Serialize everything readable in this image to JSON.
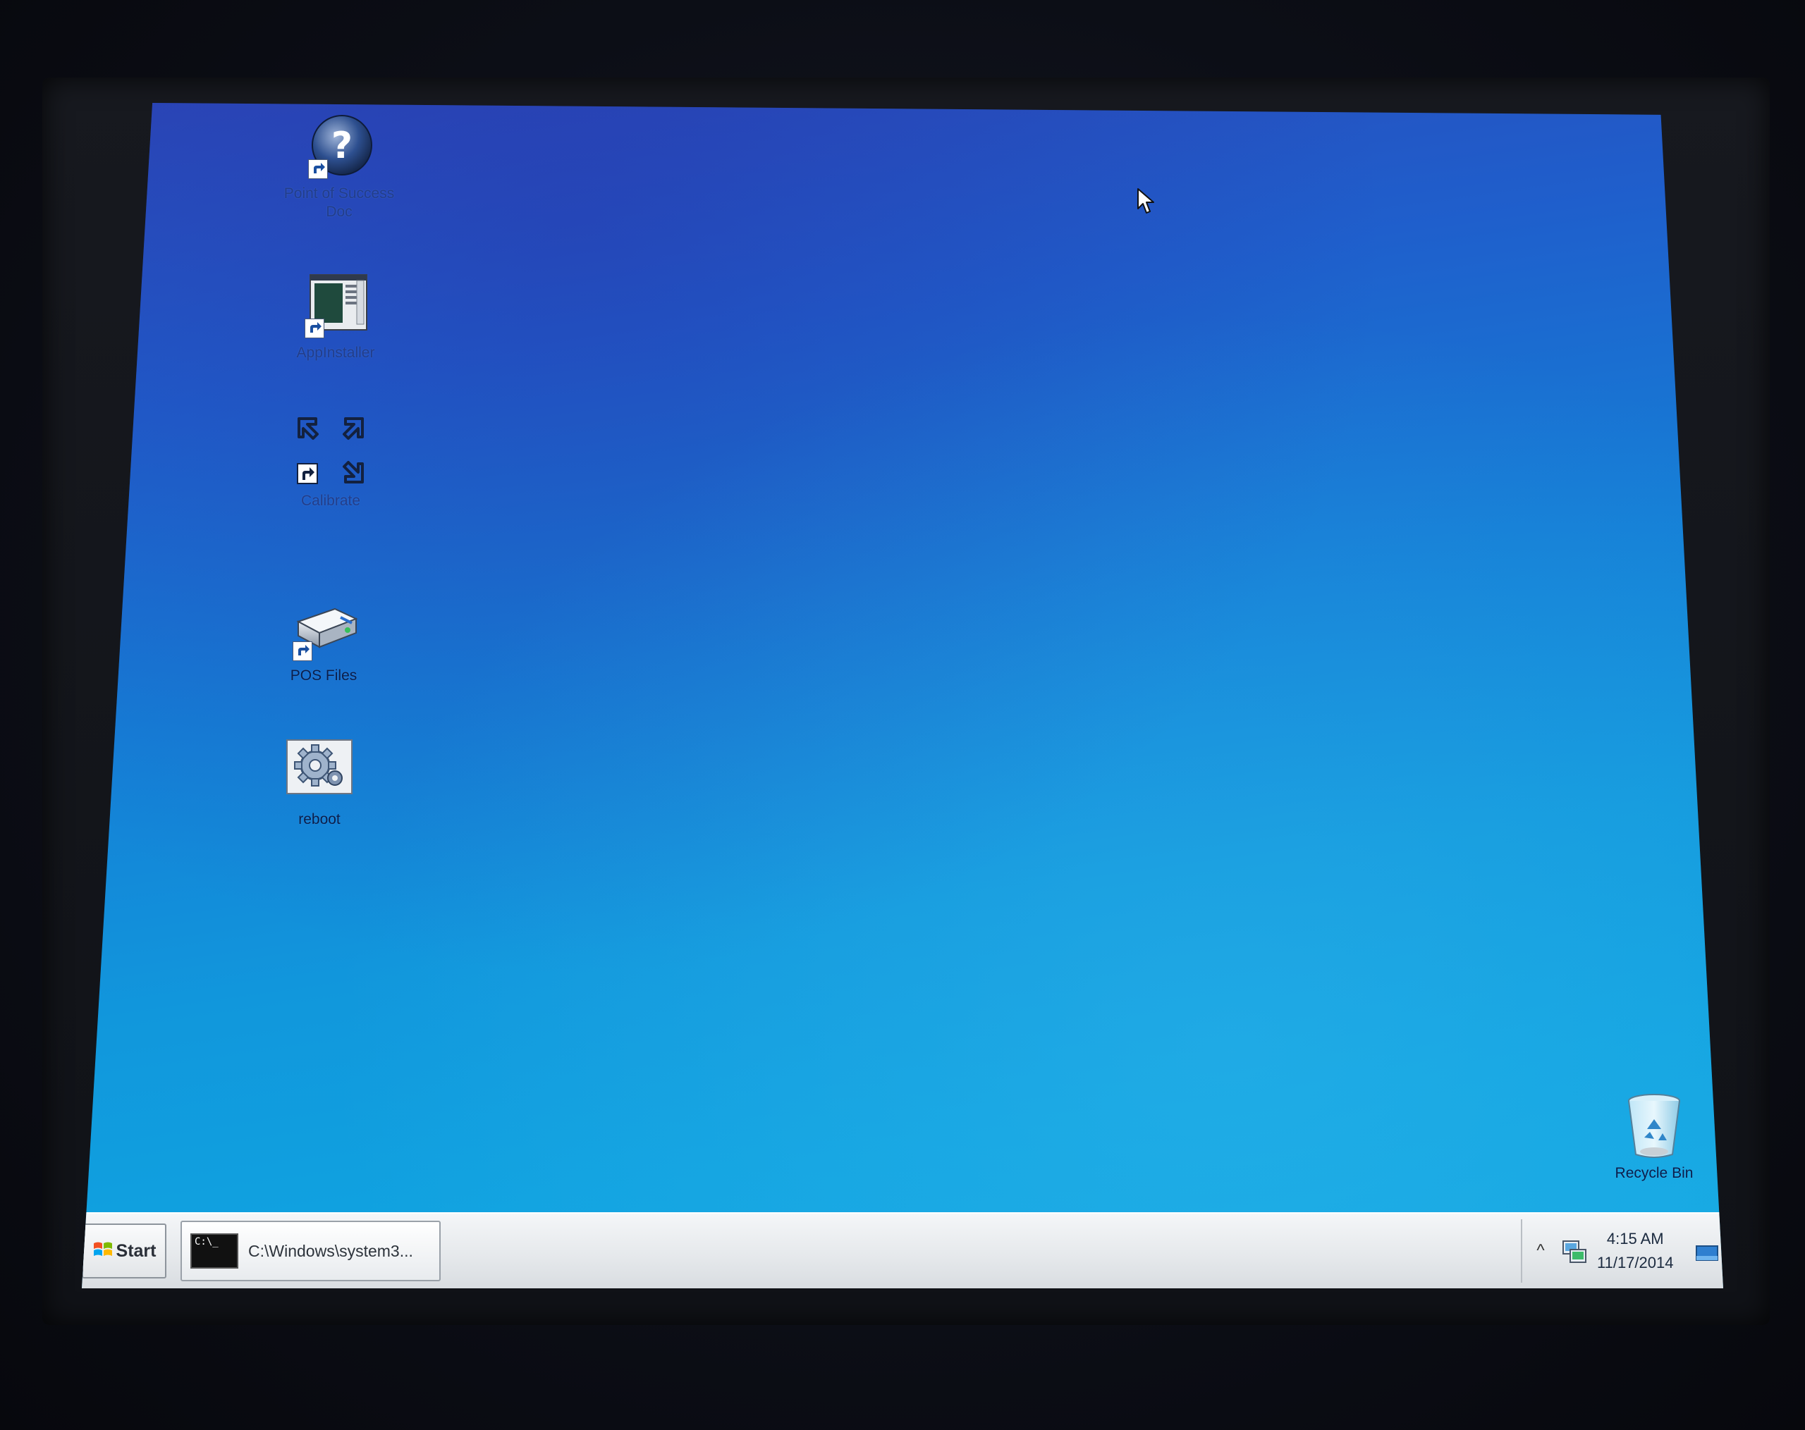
{
  "desktop": {
    "icons": [
      {
        "label": "Point of Success Doc",
        "icon": "help-question-icon",
        "faded": true
      },
      {
        "label": "AppInstaller",
        "icon": "app-installer-icon",
        "faded": false
      },
      {
        "label": "Calibrate",
        "icon": "calibrate-arrows-icon",
        "faded": false
      },
      {
        "label": "POS Files",
        "icon": "drive-icon",
        "faded": false
      },
      {
        "label": "reboot",
        "icon": "gear-settings-icon",
        "faded": false
      }
    ],
    "recycle_bin": {
      "label": "Recycle Bin",
      "icon": "recycle-bin-icon"
    }
  },
  "taskbar": {
    "start_label": "Start",
    "task_label": "C:\\Windows\\system3...",
    "cmd_icon_text": "C:\\_",
    "tray": {
      "chevron": "^",
      "time": "4:15 AM",
      "date": "11/17/2014"
    }
  },
  "colors": {
    "desktop_top": "#2a49b9",
    "desktop_bottom": "#13a8e2",
    "taskbar": "#e6e9ec"
  }
}
